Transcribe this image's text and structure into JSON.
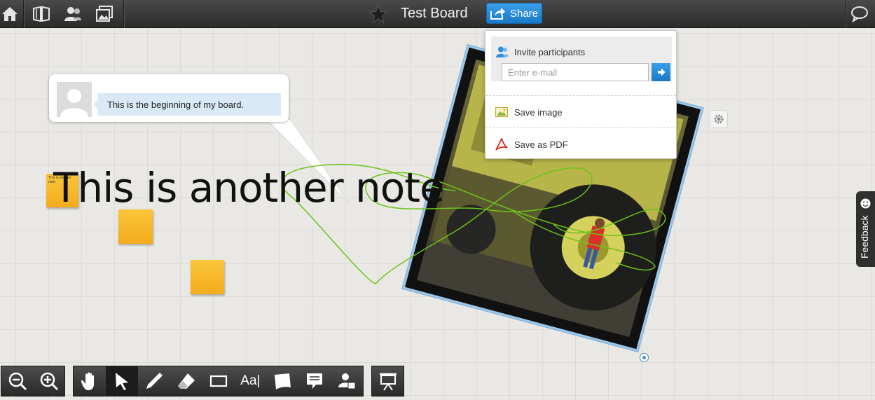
{
  "topbar": {
    "board_title": "Test Board",
    "share_label": "Share",
    "icons": [
      "home-icon",
      "boards-icon",
      "people-icon",
      "gallery-icon",
      "star-icon",
      "chat-icon"
    ]
  },
  "share_menu": {
    "invite_label": "Invite participants",
    "email_placeholder": "Enter e-mail",
    "save_image_label": "Save image",
    "save_pdf_label": "Save as PDF"
  },
  "board": {
    "bubble_text": "This is the beginning of my board.",
    "big_note_text": "This is another note",
    "sticky_small_text": "This is another note"
  },
  "feedback": {
    "label": "Feedback"
  },
  "toolbar": {
    "text_tool_label": "Aa|",
    "zoom_tools": [
      "zoom-out-icon",
      "zoom-in-icon"
    ],
    "draw_tools": [
      "hand-icon",
      "select-arrow-icon",
      "pen-icon",
      "eraser-icon",
      "rectangle-icon",
      "text-icon",
      "sticky-note-icon",
      "comment-icon",
      "user-stamp-icon"
    ],
    "present_tool": "presentation-icon"
  },
  "colors": {
    "accent": "#2a8fdc",
    "sticky": "#f7b52c",
    "doodle": "#6ec21a",
    "topbar": "#333333"
  }
}
